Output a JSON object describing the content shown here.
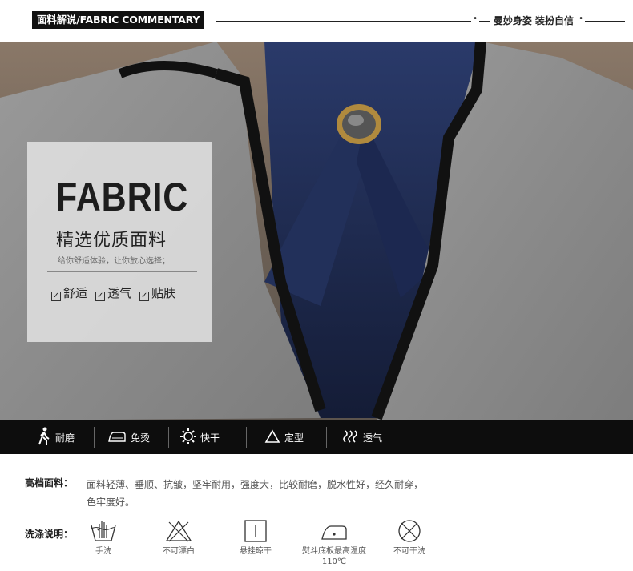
{
  "header": {
    "title": "面料解说/FABRIC COMMENTARY",
    "slogan": "曼妙身姿 装扮自信"
  },
  "card": {
    "heading": "FABRIC",
    "subheading": "精选优质面料",
    "tagline": "给你舒适体验，让你放心选择；",
    "checks": [
      "舒适",
      "透气",
      "贴肤"
    ]
  },
  "features": [
    {
      "icon": "walking-person-icon",
      "label": "耐磨"
    },
    {
      "icon": "iron-icon",
      "label": "免烫"
    },
    {
      "icon": "sun-icon",
      "label": "快干"
    },
    {
      "icon": "triangle-icon",
      "label": "定型"
    },
    {
      "icon": "wave-icon",
      "label": "透气"
    }
  ],
  "description": {
    "label": "高档面料：",
    "text": "面料轻薄、垂顺、抗皱，坚牢耐用，强度大，比较耐磨，脱水性好，经久耐穿，色牢度好。"
  },
  "care": {
    "label": "洗涤说明：",
    "items": [
      {
        "icon": "hand-wash-icon",
        "label": "手洗"
      },
      {
        "icon": "no-bleach-icon",
        "label": "不可漂白"
      },
      {
        "icon": "hang-dry-icon",
        "label": "悬挂晾干"
      },
      {
        "icon": "iron-temp-icon",
        "label": "熨斗底板最高温度110℃"
      },
      {
        "icon": "no-dry-clean-icon",
        "label": "不可干洗"
      }
    ]
  },
  "colors": {
    "bar": "#0d0d0d",
    "jacket": "#8f8f8f",
    "blouse": "#1f2a4a",
    "trim": "#111111"
  }
}
